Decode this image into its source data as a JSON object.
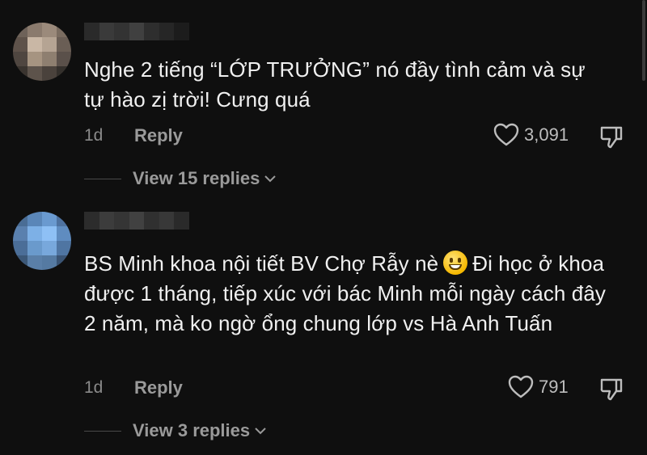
{
  "comments": [
    {
      "text": "Nghe 2 tiếng “LỚP TRƯỞNG” nó đầy tình cảm và sự tự hào zị trời! Cưng quá",
      "age": "1d",
      "reply_label": "Reply",
      "likes": "3,091",
      "view_replies": "View 15 replies"
    },
    {
      "text_before_emoji": "BS Minh khoa nội tiết BV Chợ Rẫy nè",
      "emoji": "grinning-face-emoji",
      "text_after_emoji": "Đi học ở khoa được 1 tháng, tiếp xúc với bác Minh mỗi ngày cách đây 2 năm, mà ko ngờ ổng chung lớp vs Hà Anh Tuấn",
      "age": "1d",
      "reply_label": "Reply",
      "likes": "791",
      "view_replies": "View 3 replies"
    }
  ],
  "colors": {
    "background": "#0f0f0f",
    "text": "#f0f0f0",
    "muted": "#9a9a9a"
  }
}
